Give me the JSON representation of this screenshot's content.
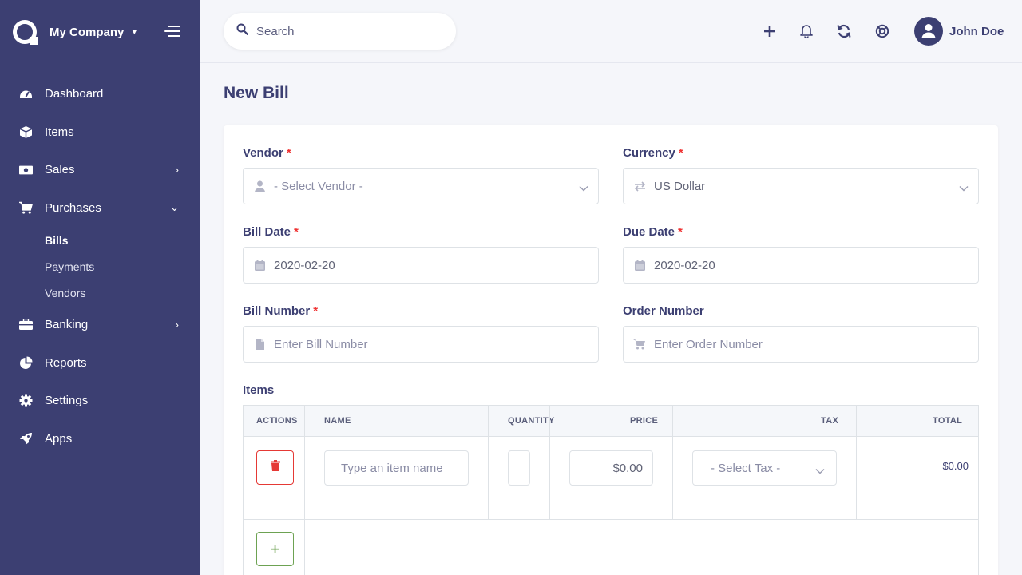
{
  "sidebar": {
    "company": "My Company",
    "menu": [
      {
        "label": "Dashboard"
      },
      {
        "label": "Items"
      },
      {
        "label": "Sales"
      },
      {
        "label": "Purchases"
      },
      {
        "label": "Banking"
      },
      {
        "label": "Reports"
      },
      {
        "label": "Settings"
      },
      {
        "label": "Apps"
      }
    ],
    "purchases_sub": [
      {
        "label": "Bills"
      },
      {
        "label": "Payments"
      },
      {
        "label": "Vendors"
      }
    ]
  },
  "topbar": {
    "search_placeholder": "Search",
    "user_name": "John Doe"
  },
  "page": {
    "title": "New Bill"
  },
  "form": {
    "vendor_label": "Vendor",
    "vendor_placeholder": "- Select Vendor -",
    "currency_label": "Currency",
    "currency_value": "US Dollar",
    "bill_date_label": "Bill Date",
    "bill_date_value": "2020-02-20",
    "due_date_label": "Due Date",
    "due_date_value": "2020-02-20",
    "bill_number_label": "Bill Number",
    "bill_number_placeholder": "Enter Bill Number",
    "order_number_label": "Order Number",
    "order_number_placeholder": "Enter Order Number",
    "required_mark": "*"
  },
  "items": {
    "label": "Items",
    "headers": {
      "actions": "ACTIONS",
      "name": "NAME",
      "quantity": "QUANTITY",
      "price": "PRICE",
      "tax": "TAX",
      "total": "TOTAL"
    },
    "row": {
      "name_placeholder": "Type an item name",
      "price": "$0.00",
      "tax_placeholder": "- Select Tax -",
      "total": "$0.00"
    },
    "add_symbol": "+"
  },
  "colors": {
    "sidebar": "#3c3f72",
    "danger": "#e53935",
    "success": "#6da252",
    "required": "#ef3232"
  },
  "icons": {
    "sidebar": [
      "dashboard-icon",
      "box-icon",
      "money-icon",
      "cart-icon",
      "briefcase-icon",
      "pie-chart-icon",
      "gear-icon",
      "rocket-icon"
    ],
    "topbar": [
      "plus-icon",
      "bell-icon",
      "refresh-icon",
      "lifebuoy-icon",
      "user-icon"
    ]
  }
}
